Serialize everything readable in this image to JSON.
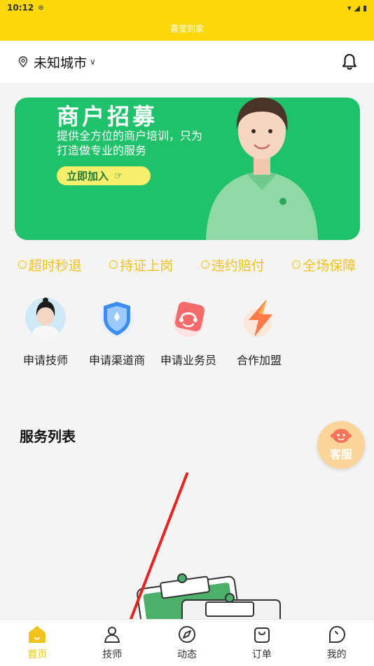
{
  "status": {
    "time": "10:12"
  },
  "app": {
    "title": "喜莹到家"
  },
  "location": {
    "city": "未知城市"
  },
  "banner": {
    "title": "商户招募",
    "subtitle": "提供全方位的商户培训，只为打造做专业的服务",
    "button": "立即加入"
  },
  "guarantees": [
    {
      "label": "超时秒退",
      "icon": "clock-icon"
    },
    {
      "label": "持证上岗",
      "icon": "person-icon"
    },
    {
      "label": "违约赔付",
      "icon": "coin-icon"
    },
    {
      "label": "全场保障",
      "icon": "check-icon"
    }
  ],
  "apply": [
    {
      "label": "申请技师",
      "icon": "technician-avatar-icon"
    },
    {
      "label": "申请渠道商",
      "icon": "shield-icon"
    },
    {
      "label": "申请业务员",
      "icon": "headset-icon"
    },
    {
      "label": "合作加盟",
      "icon": "lightning-icon"
    }
  ],
  "service_list": {
    "title": "服务列表"
  },
  "customer_service": {
    "label": "客服"
  },
  "tabs": [
    {
      "label": "首页",
      "icon": "home-icon",
      "active": true
    },
    {
      "label": "技师",
      "icon": "technician-icon",
      "active": false
    },
    {
      "label": "动态",
      "icon": "compass-icon",
      "active": false
    },
    {
      "label": "订单",
      "icon": "bag-icon",
      "active": false
    },
    {
      "label": "我的",
      "icon": "profile-icon",
      "active": false
    }
  ],
  "colors": {
    "accent": "#fcd80a",
    "banner": "#1fc16a",
    "gold": "#f1c21b",
    "arrow": "#e8231f"
  }
}
